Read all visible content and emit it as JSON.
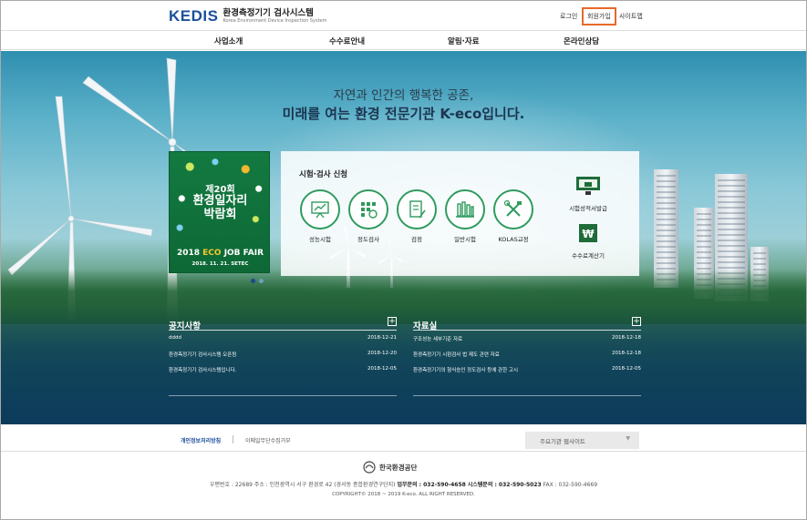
{
  "header": {
    "logo_mark": "KEDIS",
    "logo_title": "환경측정기기 검사시스템",
    "logo_subtitle": "Korea Environment Device Inspection System",
    "login": "로그인",
    "join": "회원가입",
    "sitemap": "사이트맵"
  },
  "nav": [
    "사업소개",
    "수수료안내",
    "알림·자료",
    "온라인상담"
  ],
  "hero": {
    "slogan_line1": "자연과 인간의 행복한 공존,",
    "slogan_line2": "미래를 여는 환경 전문기관 K-eco입니다."
  },
  "poster": {
    "line1": "제20회",
    "line2": "환경일자리",
    "line3": "박람회",
    "event_prefix": "2018",
    "event_eco": "ECO",
    "event_suffix": "JOB FAIR",
    "date": "2018. 11. 21.",
    "venue": "SETEC"
  },
  "services": {
    "title": "시험·검사 신청",
    "items": [
      {
        "label": "성능시험",
        "icon": "chart-board-icon"
      },
      {
        "label": "정도검사",
        "icon": "grid-check-icon"
      },
      {
        "label": "검정",
        "icon": "document-pen-icon"
      },
      {
        "label": "일반시험",
        "icon": "test-tubes-icon"
      },
      {
        "label": "KOLAS교정",
        "icon": "tools-icon"
      }
    ],
    "side": [
      {
        "label": "시험성적서발급",
        "icon": "certificate-monitor-icon"
      },
      {
        "label": "수수료계산기",
        "icon": "won-calculator-icon"
      }
    ]
  },
  "notices": {
    "title": "공지사항",
    "rows": [
      {
        "title": "dddd",
        "date": "2018-12-21"
      },
      {
        "title": "환경측정기기 검사시스템 오픈됨",
        "date": "2018-12-20"
      },
      {
        "title": "환경측정기기 검사시스템입니다.",
        "date": "2018-12-05"
      }
    ]
  },
  "archive": {
    "title": "자료실",
    "rows": [
      {
        "title": "구조성능 세부기준 자료",
        "date": "2018-12-18"
      },
      {
        "title": "환경측정기기 시험검사 법 제도 관련 자료",
        "date": "2018-12-18"
      },
      {
        "title": "환경측정기기의 형식승인 정도검사 등에 관한 고시",
        "date": "2018-12-05"
      }
    ]
  },
  "footer": {
    "privacy": "개인정보처리방침",
    "email_refusal": "이메일무단수집거부",
    "related_sites": "주요기관 웹사이트",
    "org": "한국환경공단",
    "address": "우편번호 : 22689  주소 : 인천광역시 서구 환경로 42 (경서동 종합환경연구단지)",
    "inquiry_label": "업무문의 : 032-590-4658",
    "system_label": "시스템문의 : 032-590-5023",
    "fax": "FAX : 032-590-4669",
    "copyright": "COPYRIGHT© 2018 ~ 2019 K-eco. ALL RIGHT RESERVED."
  },
  "colors": {
    "brand_blue": "#1b4f9c",
    "accent_green": "#2f9b5e",
    "join_highlight": "#e8692a"
  }
}
